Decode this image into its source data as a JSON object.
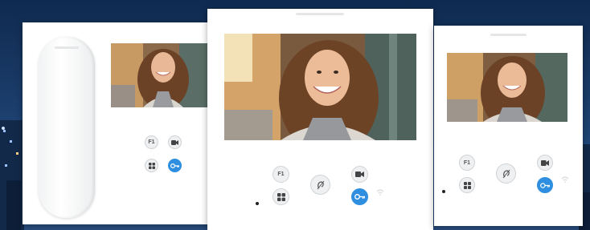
{
  "scene": {
    "background_color": "#1b3d6b",
    "accent_blue": "#2e8fe0",
    "panel_color": "#ffffff"
  },
  "monitors": [
    {
      "name": "monitor-left-with-handset",
      "buttons": [
        {
          "icon": "f1-icon",
          "label": "F1"
        },
        {
          "icon": "camera-icon",
          "label": ""
        },
        {
          "icon": "grid-icon",
          "label": ""
        },
        {
          "icon": "key-icon",
          "label": ""
        }
      ]
    },
    {
      "name": "monitor-center",
      "buttons": [
        {
          "icon": "f1-icon",
          "label": "F1"
        },
        {
          "icon": "hearing-loop-icon",
          "label": ""
        },
        {
          "icon": "camera-icon",
          "label": ""
        },
        {
          "icon": "grid-icon",
          "label": ""
        },
        {
          "icon": "key-icon",
          "label": ""
        }
      ]
    },
    {
      "name": "monitor-right",
      "buttons": [
        {
          "icon": "f1-icon",
          "label": "F1"
        },
        {
          "icon": "hearing-loop-icon",
          "label": ""
        },
        {
          "icon": "camera-icon",
          "label": ""
        },
        {
          "icon": "grid-icon",
          "label": ""
        },
        {
          "icon": "key-icon",
          "label": ""
        }
      ]
    }
  ]
}
